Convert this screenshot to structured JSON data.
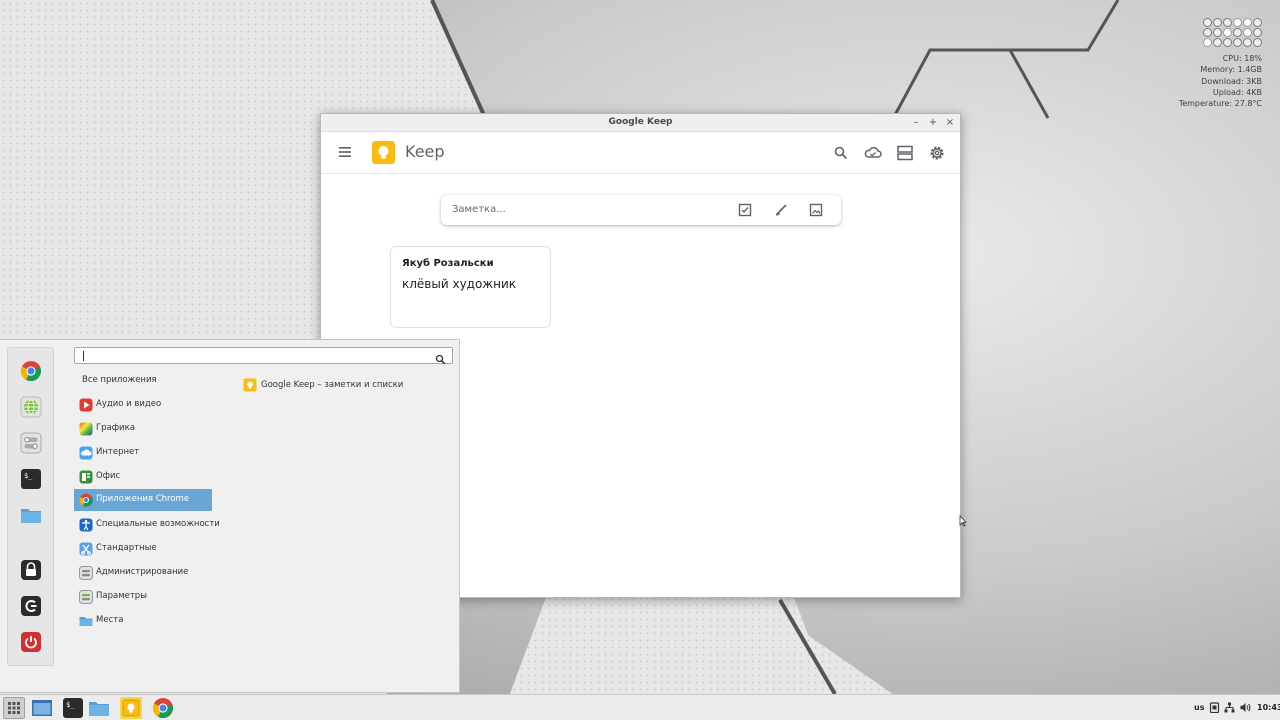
{
  "desktop": {
    "conky": {
      "cpu": "CPU: 18%",
      "memory": "Memory: 1.4GB",
      "download": "Download: 3KB",
      "upload": "Upload: 4KB",
      "temperature": "Temperature: 27.8°C"
    }
  },
  "window": {
    "title": "Google Keep",
    "controls": {
      "minimize": "–",
      "maximize": "+",
      "close": "×"
    }
  },
  "keep": {
    "app_name": "Keep",
    "header_icons": [
      "search-icon",
      "cloud-icon",
      "view-toggle-icon",
      "settings-icon"
    ],
    "note_bar": {
      "placeholder": "Заметка...",
      "icons": [
        "checkbox-icon",
        "brush-icon",
        "image-icon"
      ]
    },
    "notes": [
      {
        "title": "Якуб Розальски",
        "body": "клёвый художник"
      }
    ]
  },
  "appmenu": {
    "search_value": "",
    "favorites": [
      "chrome-icon",
      "web-icon",
      "settings-toggle-icon",
      "terminal-icon",
      "folder-icon",
      "lock-icon",
      "logout-icon",
      "power-icon"
    ],
    "categories": [
      {
        "label": "Все приложения",
        "icon": ""
      },
      {
        "label": "Аудио и видео",
        "icon": "media-icon"
      },
      {
        "label": "Графика",
        "icon": "graphics-icon"
      },
      {
        "label": "Интернет",
        "icon": "internet-icon"
      },
      {
        "label": "Офис",
        "icon": "office-icon"
      },
      {
        "label": "Приложения Chrome",
        "icon": "chrome-icon"
      },
      {
        "label": "Специальные возможности",
        "icon": "accessibility-icon"
      },
      {
        "label": "Стандартные",
        "icon": "accessories-icon"
      },
      {
        "label": "Администрирование",
        "icon": "admin-icon"
      },
      {
        "label": "Параметры",
        "icon": "preferences-icon"
      },
      {
        "label": "Места",
        "icon": "places-icon"
      }
    ],
    "selected_category": "Приложения Chrome",
    "apps": [
      {
        "label": "Google Keep – заметки и списки",
        "icon": "keep-icon"
      }
    ]
  },
  "taskbar": {
    "launchers": [
      "menu-icon",
      "desktop-icon",
      "terminal-icon",
      "files-icon",
      "keep-icon",
      "chrome-icon"
    ],
    "keyboard_layout": "us",
    "clock": "10:43"
  },
  "colors": {
    "keep_yellow": "#f9bc15",
    "selection_blue": "#6aa6d4",
    "taskbar_active": "#f5d44a"
  }
}
